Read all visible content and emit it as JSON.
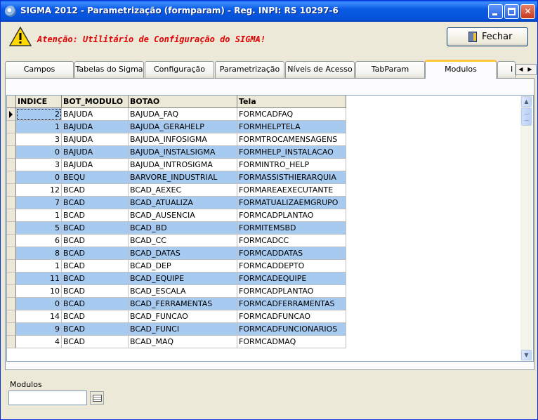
{
  "window": {
    "title": "SIGMA 2012 - Parametrização  (formparam)  - Reg. INPI: RS 10297-6"
  },
  "header": {
    "warning_text": "Atenção: Utilitário de Configuração do SIGMA!",
    "close_button_label": "Fechar"
  },
  "tabs": [
    {
      "label": "Campos"
    },
    {
      "label": "Tabelas do Sigma"
    },
    {
      "label": "Configuração"
    },
    {
      "label": "Parametrização"
    },
    {
      "label": "Níveis de Acesso"
    },
    {
      "label": "TabParam"
    },
    {
      "label": "Modulos",
      "active": true
    },
    {
      "label": "I"
    }
  ],
  "grid": {
    "columns": [
      "INDICE",
      "BOT_MODULO",
      "BOTAO",
      "Tela"
    ],
    "rows": [
      [
        "2",
        "BAJUDA",
        "BAJUDA_FAQ",
        "FORMCADFAQ"
      ],
      [
        "1",
        "BAJUDA",
        "BAJUDA_GERAHELP",
        "FORMHELPTELA"
      ],
      [
        "3",
        "BAJUDA",
        "BAJUDA_INFOSIGMA",
        "FORMTROCAMENSAGENS"
      ],
      [
        "0",
        "BAJUDA",
        "BAJUDA_INSTALSIGMA",
        "FORMHELP_INSTALACAO"
      ],
      [
        "3",
        "BAJUDA",
        "BAJUDA_INTROSIGMA",
        "FORMINTRO_HELP"
      ],
      [
        "0",
        "BEQU",
        "BARVORE_INDUSTRIAL",
        "FORMASSISTHIERARQUIA"
      ],
      [
        "12",
        "BCAD",
        "BCAD_AEXEC",
        "FORMAREAEXECUTANTE"
      ],
      [
        "7",
        "BCAD",
        "BCAD_ATUALIZA",
        "FORMATUALIZAEMGRUPO"
      ],
      [
        "1",
        "BCAD",
        "BCAD_AUSENCIA",
        "FORMCADPLANTAO"
      ],
      [
        "5",
        "BCAD",
        "BCAD_BD",
        "FORMITEMSBD"
      ],
      [
        "6",
        "BCAD",
        "BCAD_CC",
        "FORMCADCC"
      ],
      [
        "8",
        "BCAD",
        "BCAD_DATAS",
        "FORMCADDATAS"
      ],
      [
        "1",
        "BCAD",
        "BCAD_DEP",
        "FORMCADDEPTO"
      ],
      [
        "11",
        "BCAD",
        "BCAD_EQUIPE",
        "FORMCADEQUIPE"
      ],
      [
        "10",
        "BCAD",
        "BCAD_ESCALA",
        "FORMCADPLANTAO"
      ],
      [
        "0",
        "BCAD",
        "BCAD_FERRAMENTAS",
        "FORMCADFERRAMENTAS"
      ],
      [
        "14",
        "BCAD",
        "BCAD_FUNCAO",
        "FORMCADFUNCAO"
      ],
      [
        "9",
        "BCAD",
        "BCAD_FUNCI",
        "FORMCADFUNCIONARIOS"
      ],
      [
        "4",
        "BCAD",
        "BCAD_MAQ",
        "FORMCADMAQ"
      ]
    ]
  },
  "footer": {
    "modulos_label": "Modulos",
    "modulos_value": ""
  },
  "colors": {
    "alt_row": "#a6caf0",
    "warning": "#e00000",
    "title_bar": "#0553d9"
  }
}
